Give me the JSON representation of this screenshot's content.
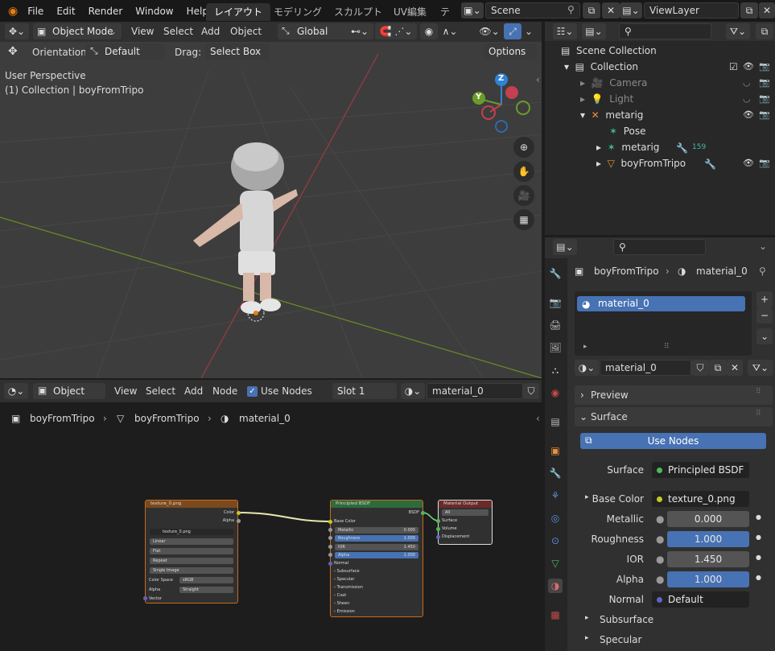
{
  "menu": [
    "File",
    "Edit",
    "Render",
    "Window",
    "Help"
  ],
  "workspaces": [
    "レイアウト",
    "モデリング",
    "スカルプト",
    "UV編集",
    "テ"
  ],
  "scene": "Scene",
  "view_layer": "ViewLayer",
  "viewport": {
    "mode": "Object Mode",
    "menus": [
      "View",
      "Select",
      "Add",
      "Object"
    ],
    "transform": "Global",
    "orientation_label": "Orientation:",
    "orientation": "Default",
    "drag_label": "Drag:",
    "drag": "Select Box",
    "options": "Options",
    "perspective": "User Perspective",
    "collection_info": "(1) Collection | boyFromTripo",
    "gizmo": {
      "z": "Z",
      "y": "Y"
    }
  },
  "node_editor": {
    "object": "Object",
    "menus": [
      "View",
      "Select",
      "Add",
      "Node"
    ],
    "use_nodes": "Use Nodes",
    "slot": "Slot 1",
    "material": "material_0",
    "breadcrumb": [
      "boyFromTripo",
      "boyFromTripo",
      "material_0"
    ]
  },
  "nodes": {
    "texture": {
      "title": "texture_0.png",
      "out_color": "Color",
      "out_alpha": "Alpha",
      "image": "texture_0.png",
      "interp": "Linear",
      "proj": "Flat",
      "ext": "Repeat",
      "source": "Single Image",
      "cs_label": "Color Space",
      "cs": "sRGB",
      "alpha_label": "Alpha",
      "alpha": "Straight",
      "vector": "Vector"
    },
    "bsdf": {
      "title": "Principled BSDF",
      "out": "BSDF",
      "base": "Base Color",
      "metallic": "Metallic",
      "metallic_v": "0.000",
      "rough": "Roughness",
      "rough_v": "1.000",
      "ior": "IOR",
      "ior_v": "1.450",
      "alpha": "Alpha",
      "alpha_v": "1.000",
      "normal": "Normal",
      "panels": [
        "Subsurface",
        "Specular",
        "Transmission",
        "Coat",
        "Sheen",
        "Emission"
      ]
    },
    "output": {
      "title": "Material Output",
      "target": "All",
      "surface": "Surface",
      "volume": "Volume",
      "displacement": "Displacement"
    }
  },
  "outliner": {
    "scene_collection": "Scene Collection",
    "rows": [
      {
        "name": "Collection"
      },
      {
        "name": "Camera"
      },
      {
        "name": "Light"
      },
      {
        "name": "metarig"
      },
      {
        "name": "Pose"
      },
      {
        "name": "metarig",
        "badge": "159"
      },
      {
        "name": "boyFromTripo"
      }
    ]
  },
  "properties": {
    "object": "boyFromTripo",
    "material": "material_0",
    "slot_item": "material_0",
    "mat_field": "material_0",
    "preview": "Preview",
    "surface_panel": "Surface",
    "use_nodes": "Use Nodes",
    "rows": [
      {
        "label": "Surface",
        "value": "Principled BSDF"
      },
      {
        "label": "Base Color",
        "value": "texture_0.png"
      },
      {
        "label": "Metallic",
        "value": "0.000"
      },
      {
        "label": "Roughness",
        "value": "1.000"
      },
      {
        "label": "IOR",
        "value": "1.450"
      },
      {
        "label": "Alpha",
        "value": "1.000"
      },
      {
        "label": "Normal",
        "value": "Default"
      }
    ],
    "subsurface": "Subsurface",
    "specular": "Specular"
  },
  "colors": {
    "accent": "#4772b3",
    "x_axis": "#9a3b45",
    "y_axis": "#6b8e23",
    "shader_green": "#4cbb58",
    "color_yellow": "#c7c729",
    "vector_blue": "#6363c7"
  }
}
